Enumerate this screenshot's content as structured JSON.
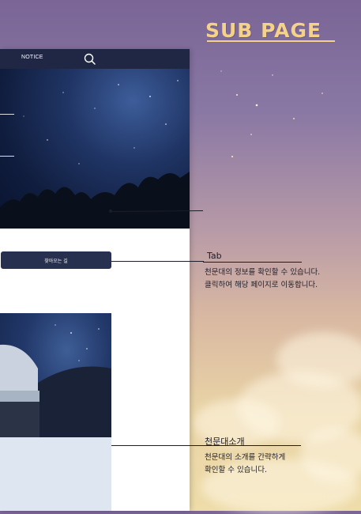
{
  "page_title": "SUB PAGE",
  "nav": {
    "notice_label": "NOTICE",
    "search_icon": "search-icon"
  },
  "tab": {
    "button_label": "찾아오는 길"
  },
  "callouts": {
    "tab": {
      "title": "Tab",
      "description": "천문대의 정보를 확인할 수 있습니다.\n클릭하여 해당 페이지로 이동합니다."
    },
    "intro": {
      "title": "천문대소개",
      "description": "천문대의 소개를 간략하게\n확인할 수 있습니다."
    }
  },
  "colors": {
    "nav_bg": "#1f2744",
    "button_bg": "#27304f",
    "title_gold": "#f4d28a",
    "panel_bg": "#dde6f1"
  }
}
